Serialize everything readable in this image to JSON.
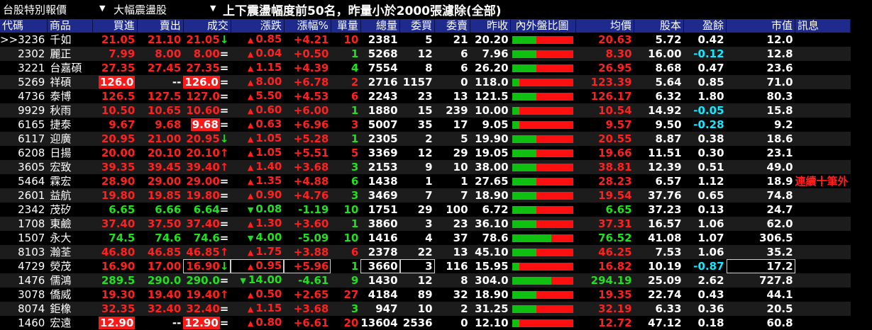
{
  "toolbar": {
    "market": "台股特別報價",
    "category": "大幅震盪股",
    "title": "上下震盪幅度前50名，昨量小於2000張濾除(全部)"
  },
  "columns": [
    "代碼",
    "商品",
    "買進",
    "賣出",
    "成交",
    "漲跌",
    "漲幅%",
    "單量",
    "總量",
    "委買",
    "委賣",
    "昨收",
    "內外盤比圖",
    "均價",
    "股本",
    "盈餘",
    "市值",
    "訊息"
  ],
  "colors": {
    "up": "#ff2020",
    "down": "#20e020",
    "flat": "#ffffff",
    "header_bg": "#1e2a8c",
    "negative_eps": "#18e8ff"
  },
  "rows": [
    {
      "code": ">>3236",
      "name": "千如",
      "bid": "21.05",
      "ask": "21.10",
      "last": "21.05",
      "mark": "↓",
      "chg": "0.85",
      "dir": "up",
      "pct": "+4.21",
      "vol": "10",
      "total": "2381",
      "bidq": "5",
      "askq": "21",
      "prev": "20.20",
      "ratio": 0.4,
      "avg": "20.63",
      "cap": "5.72",
      "eps": "0.42",
      "mv": "12.0",
      "msg": ""
    },
    {
      "code": "2302",
      "name": "麗正",
      "bid": "7.99",
      "ask": "8.00",
      "last": "8.00",
      "mark": "=",
      "chg": "0.04",
      "dir": "up",
      "pct": "+0.50",
      "vol": "1",
      "total": "5268",
      "bidq": "12",
      "askq": "6",
      "prev": "7.96",
      "ratio": 0.4,
      "avg": "8.30",
      "cap": "16.00",
      "eps": "-0.12",
      "mv": "12.8",
      "msg": ""
    },
    {
      "code": "3221",
      "name": "台嘉碩",
      "bid": "27.35",
      "ask": "27.45",
      "last": "27.35",
      "mark": "=",
      "chg": "1.15",
      "dir": "up",
      "pct": "+4.39",
      "vol": "4",
      "total": "7554",
      "bidq": "8",
      "askq": "6",
      "prev": "26.20",
      "ratio": 0.4,
      "avg": "26.95",
      "cap": "8.68",
      "eps": "0.47",
      "mv": "23.6",
      "msg": ""
    },
    {
      "code": "5269",
      "name": "祥碩",
      "bid": "126.0",
      "ask": "--",
      "last": "126.0",
      "mark": "=",
      "chg": "8.00",
      "dir": "up",
      "pct": "+6.78",
      "vol": "2",
      "total": "2716",
      "bidq": "1157",
      "askq": "0",
      "prev": "118.0",
      "ratio": 0.12,
      "avg": "123.39",
      "cap": "5.64",
      "eps": "0.85",
      "mv": "71.0",
      "msg": ""
    },
    {
      "code": "4736",
      "name": "泰博",
      "bid": "126.5",
      "ask": "127.5",
      "last": "127.0",
      "mark": "=",
      "chg": "5.50",
      "dir": "up",
      "pct": "+4.53",
      "vol": "6",
      "total": "2243",
      "bidq": "23",
      "askq": "13",
      "prev": "121.5",
      "ratio": 0.4,
      "avg": "126.17",
      "cap": "6.32",
      "eps": "1.80",
      "mv": "80.3",
      "msg": ""
    },
    {
      "code": "9929",
      "name": "秋雨",
      "bid": "10.50",
      "ask": "10.65",
      "last": "10.60",
      "mark": "=",
      "chg": "0.60",
      "dir": "up",
      "pct": "+6.00",
      "vol": "1",
      "total": "1880",
      "bidq": "15",
      "askq": "239",
      "prev": "10.00",
      "ratio": 0.12,
      "avg": "10.54",
      "cap": "14.92",
      "eps": "-0.05",
      "mv": "15.8",
      "msg": ""
    },
    {
      "code": "6165",
      "name": "捷泰",
      "bid": "9.67",
      "ask": "9.68",
      "last": "9.68",
      "mark": "=",
      "chg": "0.63",
      "dir": "up",
      "pct": "+6.96",
      "vol": "3",
      "total": "5007",
      "bidq": "35",
      "askq": "17",
      "prev": "9.05",
      "ratio": 0.12,
      "avg": "9.57",
      "cap": "9.50",
      "eps": "-0.28",
      "mv": "9.2",
      "msg": ""
    },
    {
      "code": "6117",
      "name": "迎廣",
      "bid": "20.95",
      "ask": "21.00",
      "last": "20.95",
      "mark": "↓",
      "chg": "1.05",
      "dir": "up",
      "pct": "+5.28",
      "vol": "1",
      "total": "2305",
      "bidq": "2",
      "askq": "5",
      "prev": "19.90",
      "ratio": 0.4,
      "avg": "20.55",
      "cap": "8.87",
      "eps": "0.38",
      "mv": "18.6",
      "msg": ""
    },
    {
      "code": "6208",
      "name": "日揚",
      "bid": "20.00",
      "ask": "20.10",
      "last": "20.10",
      "mark": "↑",
      "chg": "1.05",
      "dir": "up",
      "pct": "+5.51",
      "vol": "5",
      "total": "3369",
      "bidq": "12",
      "askq": "29",
      "prev": "19.05",
      "ratio": 0.4,
      "avg": "19.66",
      "cap": "11.51",
      "eps": "0.30",
      "mv": "23.1",
      "msg": ""
    },
    {
      "code": "3605",
      "name": "宏致",
      "bid": "39.35",
      "ask": "39.45",
      "last": "39.40",
      "mark": "↑",
      "chg": "1.40",
      "dir": "up",
      "pct": "+3.68",
      "vol": "3",
      "total": "2153",
      "bidq": "9",
      "askq": "10",
      "prev": "38.00",
      "ratio": 0.4,
      "avg": "38.81",
      "cap": "12.39",
      "eps": "0.51",
      "mv": "49.0",
      "msg": ""
    },
    {
      "code": "5464",
      "name": "霖宏",
      "bid": "28.90",
      "ask": "29.00",
      "last": "29.00",
      "mark": "=",
      "chg": "1.35",
      "dir": "up",
      "pct": "+4.88",
      "vol": "6",
      "total": "1438",
      "bidq": "1",
      "askq": "1",
      "prev": "27.65",
      "ratio": 0.4,
      "avg": "28.23",
      "cap": "6.57",
      "eps": "1.12",
      "mv": "18.9",
      "msg": "連續十筆外"
    },
    {
      "code": "2601",
      "name": "益航",
      "bid": "19.80",
      "ask": "19.85",
      "last": "19.80",
      "mark": "=",
      "chg": "0.90",
      "dir": "up",
      "pct": "+4.76",
      "vol": "3",
      "total": "3469",
      "bidq": "7",
      "askq": "7",
      "prev": "18.90",
      "ratio": 0.4,
      "avg": "19.54",
      "cap": "37.76",
      "eps": "0.65",
      "mv": "74.8",
      "msg": ""
    },
    {
      "code": "2342",
      "name": "茂矽",
      "bid": "6.65",
      "ask": "6.66",
      "last": "6.64",
      "mark": "=",
      "chg": "0.08",
      "dir": "down",
      "pct": "-1.19",
      "vol": "10",
      "total": "1751",
      "bidq": "29",
      "askq": "100",
      "prev": "6.72",
      "ratio": 0.4,
      "avg": "6.65",
      "cap": "37.23",
      "eps": "0.13",
      "mv": "24.7",
      "msg": ""
    },
    {
      "code": "1708",
      "name": "東鹼",
      "bid": "37.40",
      "ask": "37.50",
      "last": "37.40",
      "mark": "=",
      "chg": "1.30",
      "dir": "up",
      "pct": "+3.60",
      "vol": "1",
      "total": "3860",
      "bidq": "3",
      "askq": "23",
      "prev": "36.10",
      "ratio": 0.4,
      "avg": "37.31",
      "cap": "16.57",
      "eps": "1.06",
      "mv": "62.0",
      "msg": ""
    },
    {
      "code": "1507",
      "name": "永大",
      "bid": "74.5",
      "ask": "74.6",
      "last": "74.6",
      "mark": "=",
      "chg": "4.00",
      "dir": "down",
      "pct": "-5.09",
      "vol": "10",
      "total": "1416",
      "bidq": "4",
      "askq": "37",
      "prev": "78.6",
      "ratio": 0.65,
      "avg": "76.52",
      "cap": "41.08",
      "eps": "1.07",
      "mv": "306.5",
      "msg": ""
    },
    {
      "code": "8103",
      "name": "瀚荃",
      "bid": "46.80",
      "ask": "46.85",
      "last": "46.85",
      "mark": "↑",
      "chg": "1.75",
      "dir": "up",
      "pct": "+3.88",
      "vol": "6",
      "total": "2378",
      "bidq": "22",
      "askq": "13",
      "prev": "45.10",
      "ratio": 0.4,
      "avg": "46.25",
      "cap": "7.53",
      "eps": "1.06",
      "mv": "35.2",
      "msg": ""
    },
    {
      "code": "4729",
      "name": "熒茂",
      "bid": "16.90",
      "ask": "17.00",
      "last": "16.90",
      "mark": "↓",
      "chg": "0.95",
      "dir": "up",
      "pct": "+5.96",
      "vol": "1",
      "total": "3660",
      "bidq": "3",
      "askq": "116",
      "prev": "15.95",
      "ratio": 0.12,
      "avg": "16.82",
      "cap": "10.19",
      "eps": "-0.87",
      "mv": "17.2",
      "msg": ""
    },
    {
      "code": "1476",
      "name": "儒鴻",
      "bid": "289.5",
      "ask": "290.0",
      "last": "290.0",
      "mark": "=",
      "chg": "14.00",
      "dir": "down",
      "pct": "-4.61",
      "vol": "9",
      "total": "1430",
      "bidq": "12",
      "askq": "8",
      "prev": "304.0",
      "ratio": 0.65,
      "avg": "294.19",
      "cap": "25.09",
      "eps": "2.62",
      "mv": "727.8",
      "msg": ""
    },
    {
      "code": "3078",
      "name": "僑威",
      "bid": "19.30",
      "ask": "19.40",
      "last": "19.40",
      "mark": "↑",
      "chg": "0.50",
      "dir": "up",
      "pct": "+2.65",
      "vol": "27",
      "total": "4184",
      "bidq": "89",
      "askq": "32",
      "prev": "18.90",
      "ratio": 0.4,
      "avg": "19.35",
      "cap": "22.74",
      "eps": "0.43",
      "mv": "44.1",
      "msg": ""
    },
    {
      "code": "8074",
      "name": "鉅橡",
      "bid": "32.35",
      "ask": "32.40",
      "last": "32.40",
      "mark": "=",
      "chg": "1.15",
      "dir": "up",
      "pct": "+3.68",
      "vol": "3",
      "total": "947",
      "bidq": "10",
      "askq": "2",
      "prev": "31.25",
      "ratio": 0.4,
      "avg": "32.19",
      "cap": "6.33",
      "eps": "0.36",
      "mv": "20.5",
      "msg": ""
    },
    {
      "code": "1460",
      "name": "宏遠",
      "bid": "12.90",
      "ask": "--",
      "last": "12.90",
      "mark": "=",
      "chg": "0.80",
      "dir": "up",
      "pct": "+6.61",
      "vol": "20",
      "total": "13604",
      "bidq": "2536",
      "askq": "0",
      "prev": "12.10",
      "ratio": 0.12,
      "avg": "12.72",
      "cap": "47.12",
      "eps": "0.18",
      "mv": "60.8",
      "msg": ""
    }
  ]
}
